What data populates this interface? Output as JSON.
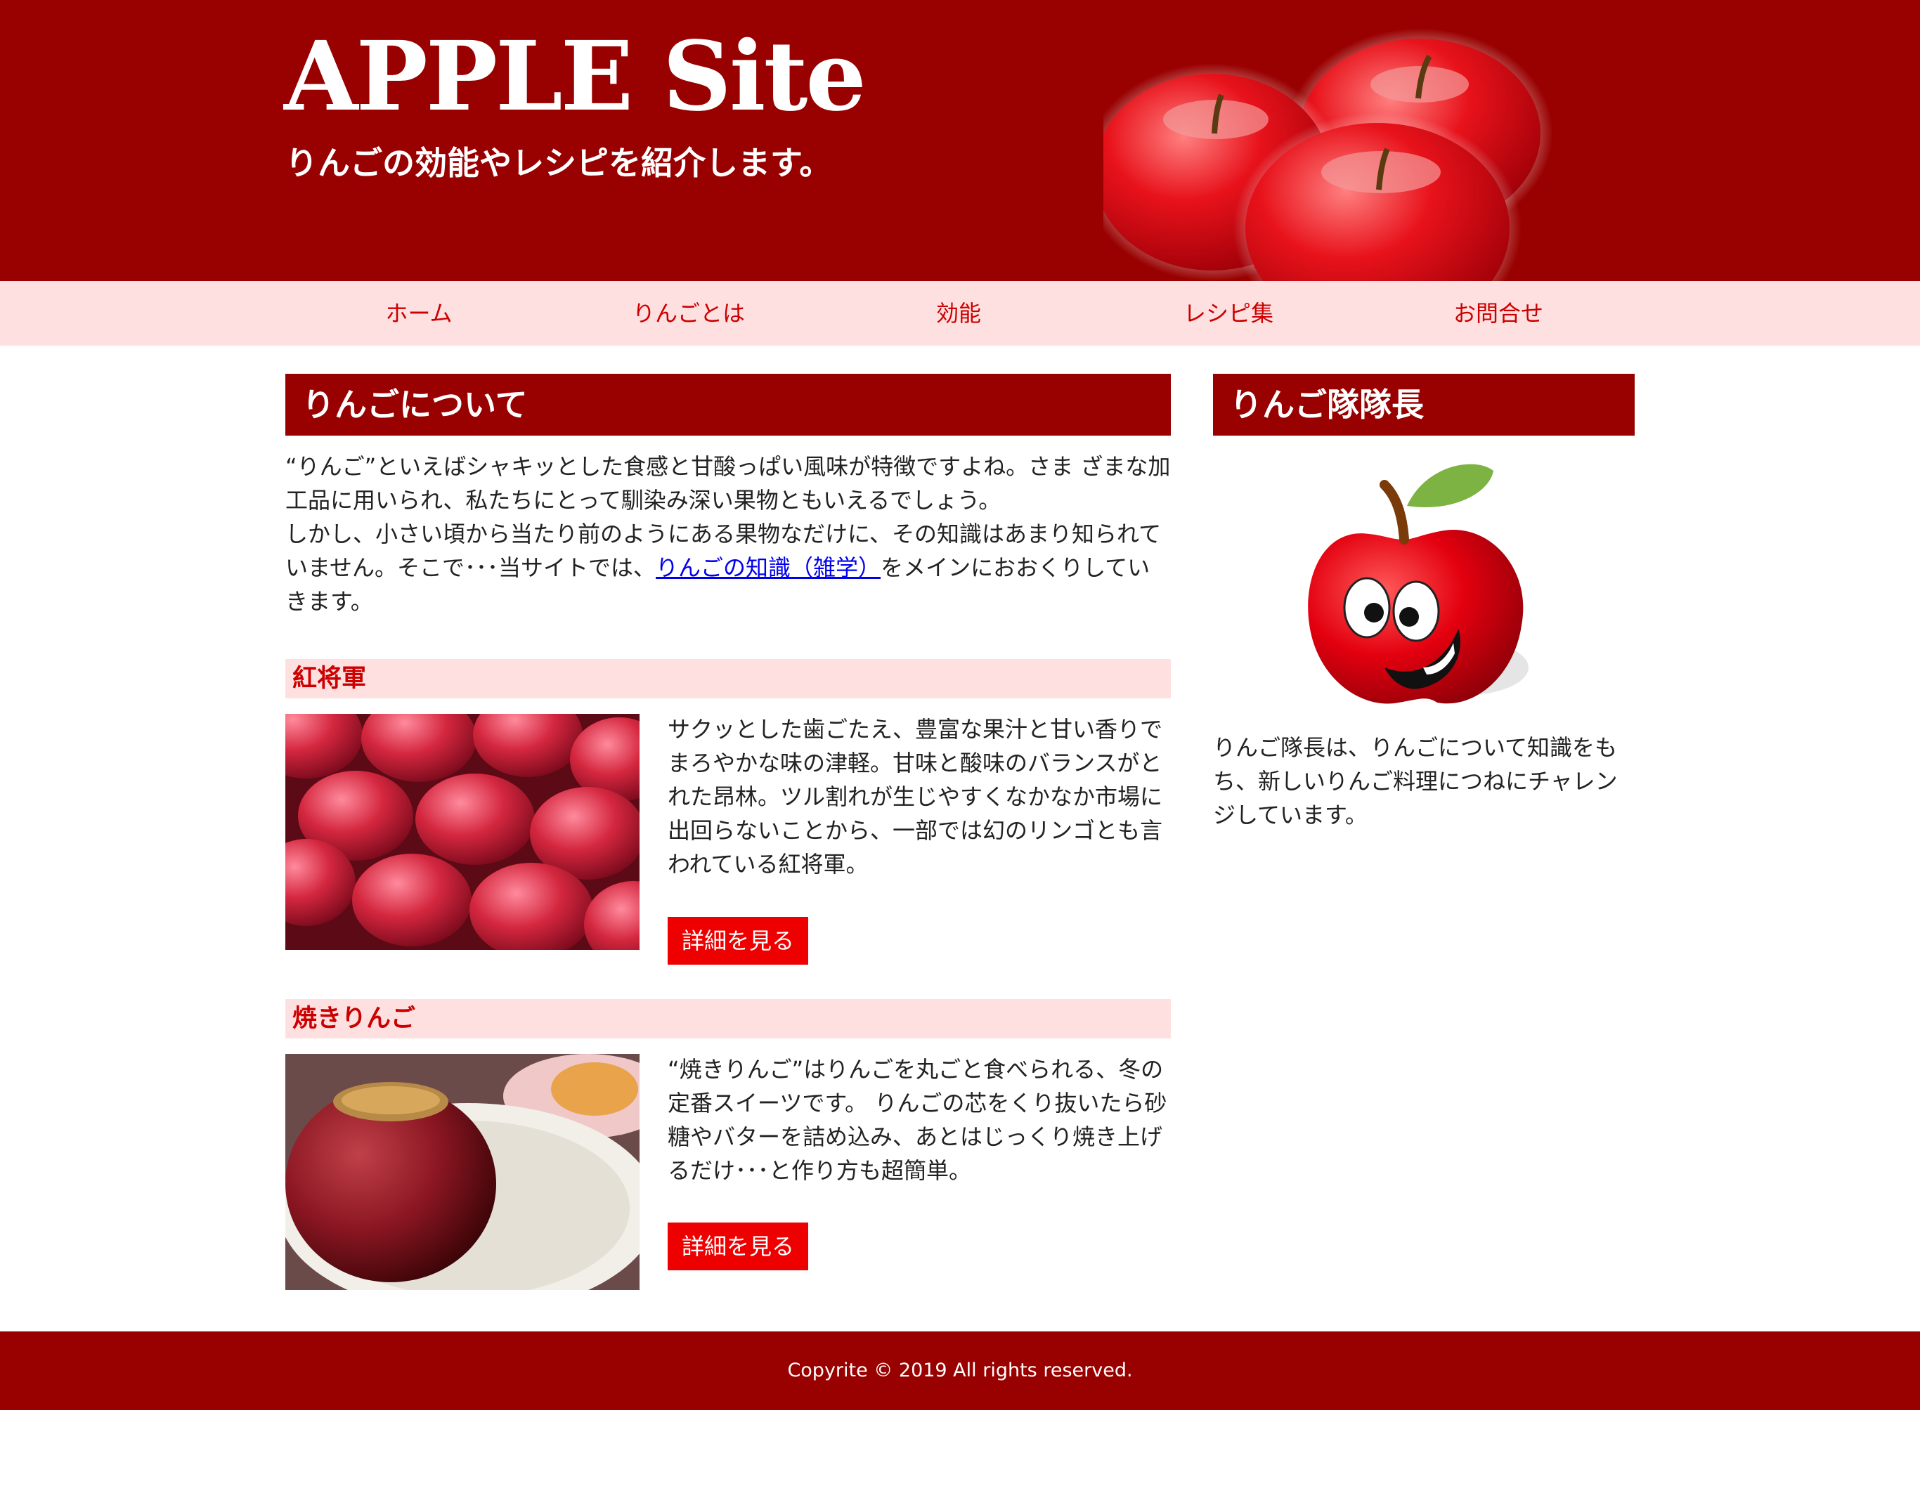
{
  "header": {
    "title": "APPLE Site",
    "tagline": "りんごの効能やレシピを紹介します。"
  },
  "nav": [
    "ホーム",
    "りんごとは",
    "効能",
    "レシピ集",
    "お問合せ"
  ],
  "main": {
    "about": {
      "heading": "りんごについて",
      "text1": "“りんご”といえばシャキッとした食感と甘酸っぱい風味が特徴ですよね。さま ざまな加工品に用いられ、私たちにとって馴染み深い果物ともいえるでしょう。",
      "text2_before": "しかし、小さい頃から当たり前のようにある果物なだけに、その知識はあまり知られていません。そこで･･･当サイトでは、",
      "link": "りんごの知識（雑学）",
      "text2_after": "をメインにおおくりしていきます。"
    },
    "articles": [
      {
        "heading": "紅将軍",
        "text": "サクッとした歯ごたえ、豊富な果汁と甘い香りでまろやかな味の津軽。甘味と酸味のバランスがとれた昂林。ツル割れが生じやすくなかなか市場に出回らないことから、一部では幻のリンゴとも言われている紅将軍。",
        "button": "詳細を見る"
      },
      {
        "heading": "焼きりんご",
        "text": "“焼きりんご”はりんごを丸ごと食べられる、冬の定番スイーツです。 りんごの芯をくり抜いたら砂糖やバターを詰め込み、あとはじっくり焼き上げるだけ･･･と作り方も超簡単。",
        "button": "詳細を見る"
      }
    ]
  },
  "sidebar": {
    "heading": "りんご隊隊長",
    "text": "りんご隊長は、りんごについて知識をもち、新しいりんご料理につねにチャレンジしています。"
  },
  "footer": {
    "copyright": "Copyrite © 2019 All rights reserved."
  },
  "colors": {
    "brand": "#990000",
    "nav_bg": "#ffe0e0",
    "nav_text": "#cc0000",
    "button": "#ee0000",
    "link": "#0000ee"
  }
}
